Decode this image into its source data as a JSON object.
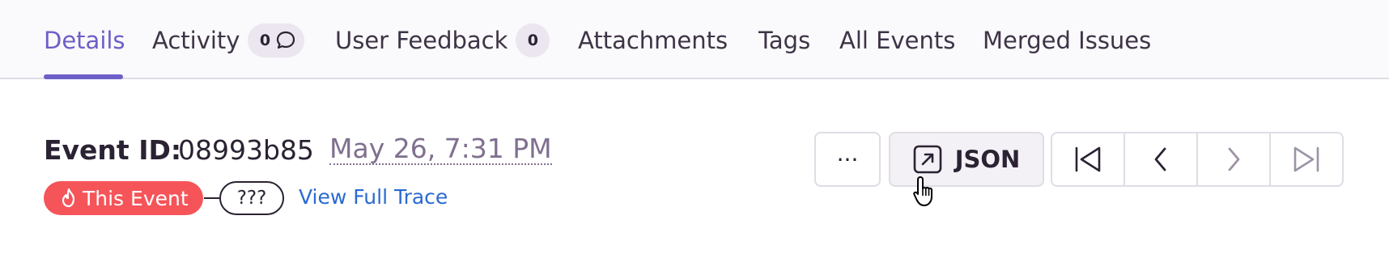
{
  "tabs": [
    {
      "label": "Details",
      "active": true
    },
    {
      "label": "Activity",
      "badge": "0",
      "badge_icon": "comment-icon"
    },
    {
      "label": "User Feedback",
      "badge": "0"
    },
    {
      "label": "Attachments"
    },
    {
      "label": "Tags"
    },
    {
      "label": "All Events"
    },
    {
      "label": "Merged Issues"
    }
  ],
  "event": {
    "label": "Event ID:",
    "id": "08993b85",
    "date": "May 26, 7:31 PM"
  },
  "trace": {
    "this_event_label": "This Event",
    "this_event_icon": "fire-icon",
    "unknown_label": "???",
    "view_full_trace": "View Full Trace"
  },
  "actions": {
    "more_label": "···",
    "json_label": "JSON",
    "json_icon": "open-external-icon"
  },
  "navigation": {
    "first": "first-event-icon",
    "previous": "previous-event-icon",
    "next": "next-event-icon",
    "last": "last-event-icon"
  },
  "colors": {
    "accent": "#6c5fc7",
    "this_event": "#f55459",
    "link": "#2b6ad1",
    "muted": "#80708f"
  }
}
